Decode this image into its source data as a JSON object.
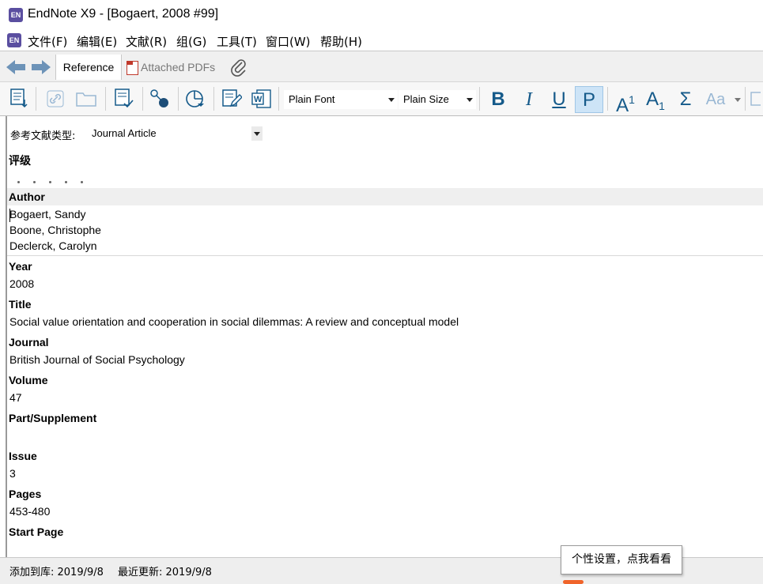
{
  "window": {
    "title": "EndNote X9 - [Bogaert, 2008 #99]",
    "app_icon_text": "EN"
  },
  "menu": [
    "文件(F)",
    "编辑(E)",
    "文献(R)",
    "组(G)",
    "工具(T)",
    "窗口(W)",
    "帮助(H)"
  ],
  "tabs": {
    "reference": "Reference",
    "attached_pdfs": "Attached PDFs"
  },
  "toolbar": {
    "font": "Plain Font",
    "size": "Plain Size",
    "bold": "B",
    "italic": "I",
    "underline": "U",
    "plain": "P",
    "superscript_base": "A",
    "superscript_sup": "1",
    "subscript_base": "A",
    "subscript_sub": "1",
    "symbol": "Σ",
    "case": "Aa",
    "active_format": "P"
  },
  "reference": {
    "type_label": "参考文献类型:",
    "type_value": "Journal Article",
    "rating_label": "评级",
    "rating_value": 0,
    "fields": {
      "author_label": "Author",
      "authors": [
        "Bogaert, Sandy",
        "Boone, Christophe",
        "Declerck, Carolyn"
      ],
      "year_label": "Year",
      "year": "2008",
      "title_label": "Title",
      "title": "Social value orientation and cooperation in social dilemmas: A review and conceptual model",
      "journal_label": "Journal",
      "journal": "British Journal of Social Psychology",
      "volume_label": "Volume",
      "volume": "47",
      "part_label": "Part/Supplement",
      "part": "",
      "issue_label": "Issue",
      "issue": "3",
      "pages_label": "Pages",
      "pages": "453-480",
      "start_page_label": "Start Page"
    }
  },
  "status": {
    "added": "添加到库: 2019/9/8",
    "updated": "最近更新: 2019/9/8"
  },
  "tooltip": "个性设置，点我看看",
  "colors": {
    "accent_blue": "#155a8a",
    "active_button_bg": "#cde4f7",
    "tooltip_tail": "#f0642a"
  }
}
